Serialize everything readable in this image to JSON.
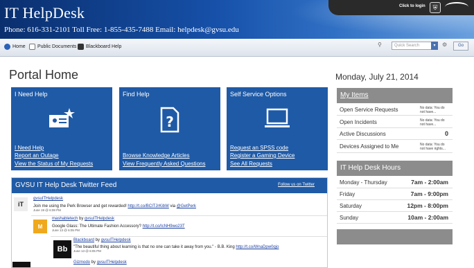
{
  "header": {
    "title": "IT HelpDesk",
    "phone_line": "Phone: 616-331-2101 Toll Free: 1-855-435-7488 Email: helpdesk@gvsu.edu",
    "login_text": "Click to login"
  },
  "nav": {
    "items": [
      {
        "label": "Home",
        "icon": "gvsu-icon"
      },
      {
        "label": "Public Documents",
        "icon": "documents-icon"
      },
      {
        "label": "Blackboard Help",
        "icon": "blackboard-icon"
      }
    ],
    "search_placeholder": "Quick Search",
    "go_label": "Go"
  },
  "page_title": "Portal Home",
  "date": "Monday, July 21, 2014",
  "tiles": [
    {
      "title": "I Need Help",
      "links": [
        "I Need Help",
        "Report an Outage",
        "View the Status of My Requests"
      ],
      "icon": "id-card-alert-icon"
    },
    {
      "title": "Find Help",
      "links": [
        "Browse Knowledge Articles",
        "View Frequently Asked Questions"
      ],
      "icon": "question-document-icon"
    },
    {
      "title": "Self Service Options",
      "links": [
        "Request an SPSS code",
        "Register a Gaming Device",
        "See All Requests"
      ],
      "icon": "laptop-icon"
    }
  ],
  "twitter": {
    "title": "GVSU IT Help Desk Twitter Feed",
    "follow_label": "Follow us on Twitter",
    "tweets": [
      {
        "user": "gvsuITHelpdesk",
        "prefix": "",
        "text": "Join me using the Perk Browser and get rewarded!",
        "link": "http://t.co/BCITJrKibW",
        "suffix": " via ",
        "mention": "@GetPerk",
        "date": "June 19 @ 6:08 PM"
      },
      {
        "user": "mashabletech",
        "prefix": " by ",
        "by": "gvsuITHelpdesk",
        "text": "Google Glass: The Ultimate Fashion Accessory?",
        "link": "http://t.co/IcNH9wo23T",
        "date": "June 13 @ 6:05 PM"
      },
      {
        "user": "Blackboard",
        "prefix": " by ",
        "by": "gvsuITHelpdesk",
        "text": "\"The beautiful thing about learning is that no one can take it away from you.\" - B.B. King",
        "link": "http://t.co/WnaDpw0qjo",
        "date": "June 13 @ 6:05 PM"
      },
      {
        "user": "Gizmodo",
        "prefix": " by ",
        "by": "gvsuITHelpdesk"
      }
    ]
  },
  "my_items": {
    "title": "My Items",
    "rows": [
      {
        "label": "Open Service Requests",
        "value": "No data: You do not have..."
      },
      {
        "label": "Open Incidents",
        "value": "No data: You do not have..."
      },
      {
        "label": "Active Discussions",
        "count": "0"
      },
      {
        "label": "Devices Assigned to Me",
        "value": "No data: You do not have rights..."
      }
    ]
  },
  "hours": {
    "title": "IT Help Desk Hours",
    "rows": [
      {
        "day": "Monday - Thursday",
        "time": "7am - 2:00am"
      },
      {
        "day": "Friday",
        "time": "7am - 9:00pm"
      },
      {
        "day": "Saturday",
        "time": "12pm - 8:00pm"
      },
      {
        "day": "Sunday",
        "time": "10am - 2:00am"
      }
    ]
  }
}
